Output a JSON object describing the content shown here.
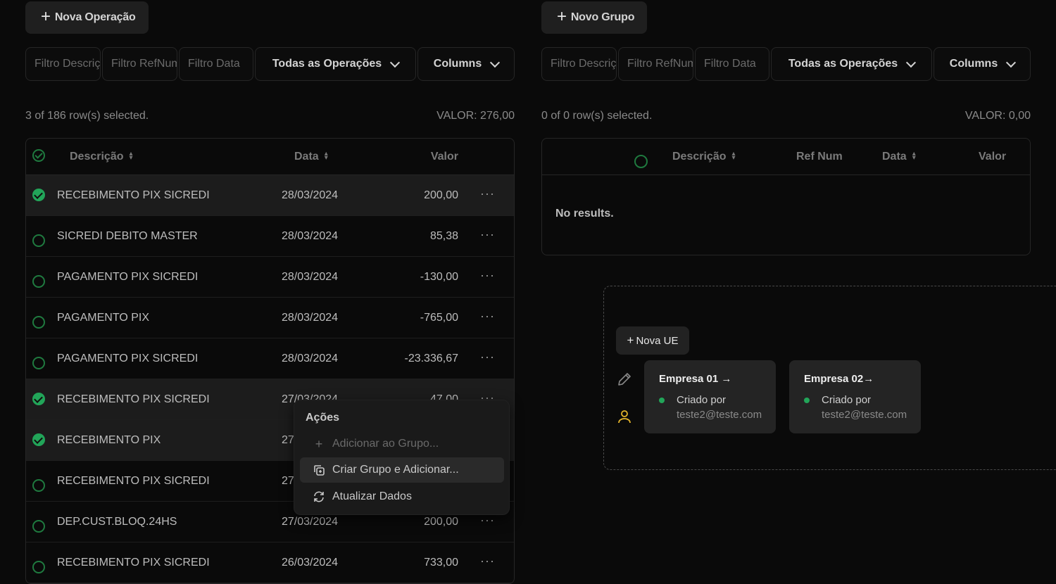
{
  "left": {
    "new_button": "Nova Operação",
    "filters": {
      "desc": "Filtro Descrição",
      "ref": "Filtro RefNum",
      "date": "Filtro Data",
      "ops": "Todas as Operações",
      "columns": "Columns"
    },
    "status": "3 of 186 row(s) selected.",
    "total": "VALOR: 276,00",
    "headers": {
      "desc": "Descrição",
      "date": "Data",
      "value": "Valor"
    },
    "rows": [
      {
        "desc": "RECEBIMENTO PIX SICREDI",
        "date": "28/03/2024",
        "value": "200,00",
        "selected": true
      },
      {
        "desc": "SICREDI DEBITO MASTER",
        "date": "28/03/2024",
        "value": "85,38",
        "selected": false
      },
      {
        "desc": "PAGAMENTO PIX SICREDI",
        "date": "28/03/2024",
        "value": "-130,00",
        "selected": false
      },
      {
        "desc": "PAGAMENTO PIX",
        "date": "28/03/2024",
        "value": "-765,00",
        "selected": false
      },
      {
        "desc": "PAGAMENTO PIX SICREDI",
        "date": "28/03/2024",
        "value": "-23.336,67",
        "selected": false
      },
      {
        "desc": "RECEBIMENTO PIX SICREDI",
        "date": "27/03/2024",
        "value": "47,00",
        "selected": true
      },
      {
        "desc": "RECEBIMENTO PIX",
        "date": "27/03/2024",
        "value": "",
        "selected": true
      },
      {
        "desc": "RECEBIMENTO PIX SICREDI",
        "date": "27/03/2024",
        "value": "",
        "selected": false
      },
      {
        "desc": "DEP.CUST.BLOQ.24HS",
        "date": "27/03/2024",
        "value": "200,00",
        "selected": false
      },
      {
        "desc": "RECEBIMENTO PIX SICREDI",
        "date": "26/03/2024",
        "value": "733,00",
        "selected": false
      }
    ]
  },
  "menu": {
    "title": "Ações",
    "add_to_group": "Adicionar ao Grupo...",
    "create_group": "Criar Grupo e Adicionar...",
    "refresh": "Atualizar Dados"
  },
  "right": {
    "new_button": "Novo Grupo",
    "filters": {
      "desc": "Filtro Descrição",
      "ref": "Filtro RefNum",
      "date": "Filtro Data",
      "ops": "Todas as Operações",
      "columns": "Columns"
    },
    "status": "0 of 0 row(s) selected.",
    "total": "VALOR: 0,00",
    "headers": {
      "desc": "Descrição",
      "ref": "Ref Num",
      "date": "Data",
      "value": "Valor"
    },
    "empty": "No results."
  },
  "ue": {
    "new_button": "Nova UE",
    "cards": [
      {
        "title": "Empresa 01 →",
        "created_label": "Criado por",
        "email": "teste2@teste.com"
      },
      {
        "title": "Empresa 02→",
        "created_label": "Criado por",
        "email": "teste2@teste.com"
      }
    ]
  },
  "colors": {
    "background": "#0a0a0a",
    "accent_green": "#22a559",
    "user_icon": "#e5b52a"
  }
}
